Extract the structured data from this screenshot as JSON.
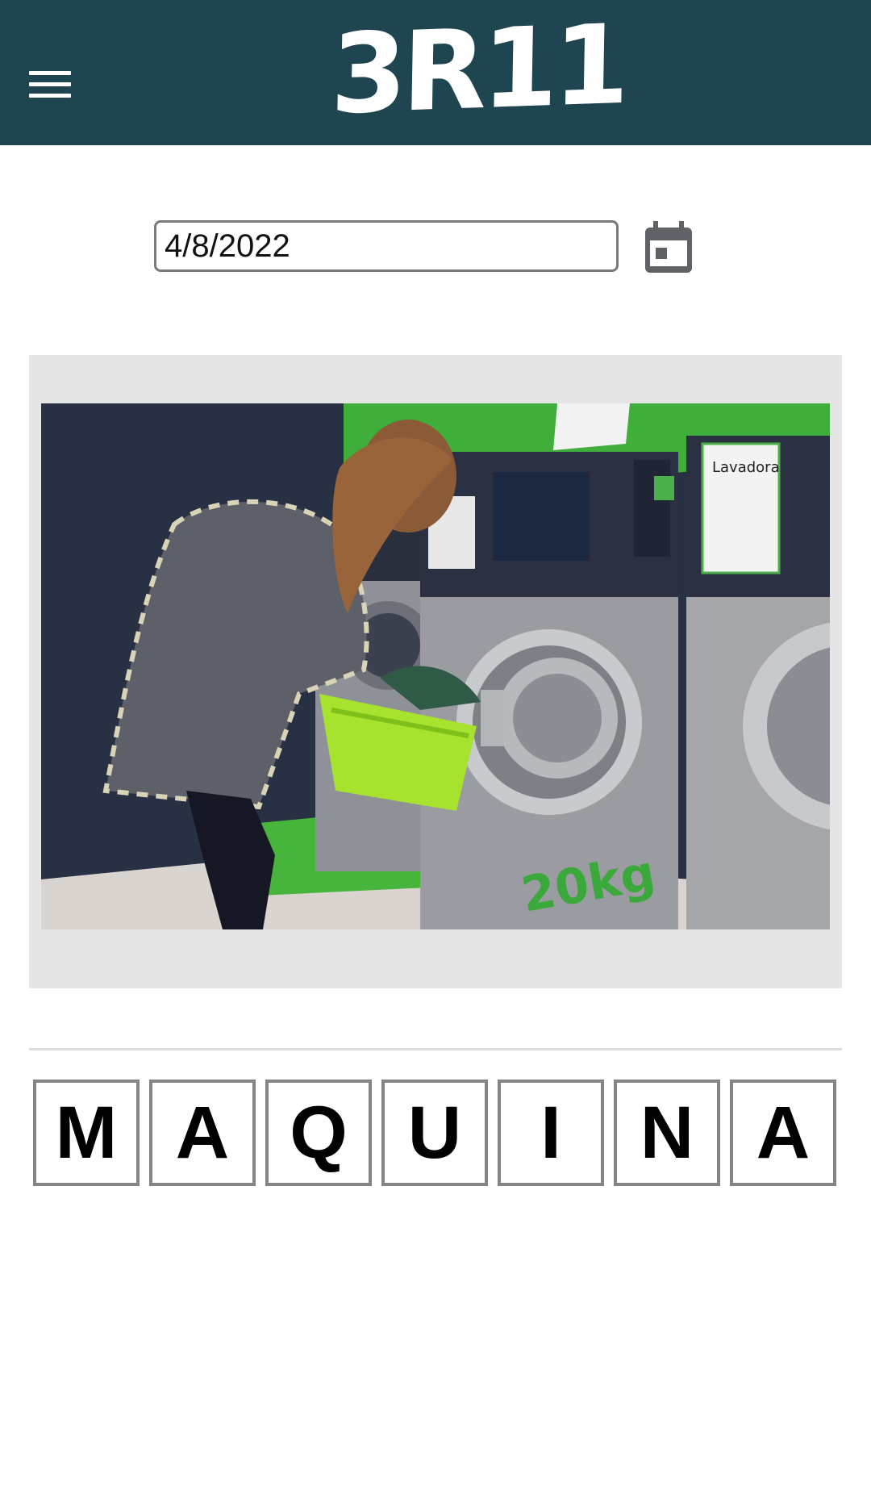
{
  "header": {
    "logo_text": "3R11",
    "menu_icon": "hamburger-menu-icon",
    "background_color": "#1f4650"
  },
  "date_picker": {
    "value": "4/8/2022",
    "icon": "calendar-icon",
    "icon_color": "#5f6368"
  },
  "puzzle_image": {
    "description_icon": "laundromat-photo"
  },
  "answer": {
    "letters": [
      "M",
      "A",
      "Q",
      "U",
      "I",
      "N",
      "A"
    ]
  }
}
